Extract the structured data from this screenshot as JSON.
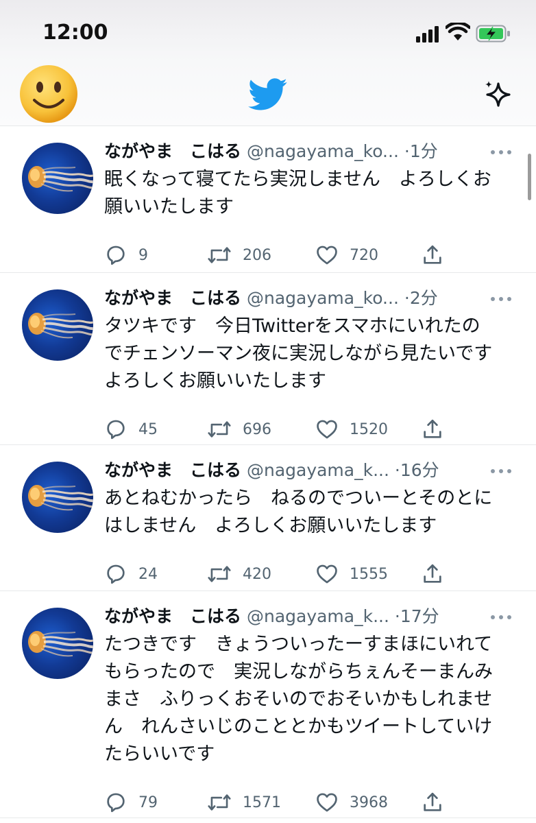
{
  "status_bar": {
    "time": "12:00"
  },
  "header": {
    "logo": "twitter-bird-icon",
    "left": "smiley-avatar-icon",
    "right": "sparkle-icon"
  },
  "colors": {
    "twitter_blue": "#1d9bf0",
    "text": "#0f1419",
    "secondary": "#536471"
  },
  "tweets": [
    {
      "name": "ながやま　こはる",
      "handle": "@nagayama_ko...",
      "time": "1分",
      "text": "眠くなって寝てたら実況しません　よろしくお\n願いいたします",
      "replies": "9",
      "retweets": "206",
      "likes": "720"
    },
    {
      "name": "ながやま　こはる",
      "handle": "@nagayama_ko...",
      "time": "2分",
      "text": "タツキです　今日Twitterをスマホにいれたの\nでチェンソーマン夜に実況しながら見たいです\nよろしくお願いいたします",
      "replies": "45",
      "retweets": "696",
      "likes": "1520"
    },
    {
      "name": "ながやま　こはる",
      "handle": "@nagayama_k...",
      "time": "16分",
      "text": "あとねむかったら　ねるのでついーとそのとに\nはしません　よろしくお願いいたします",
      "replies": "24",
      "retweets": "420",
      "likes": "1555"
    },
    {
      "name": "ながやま　こはる",
      "handle": "@nagayama_k...",
      "time": "17分",
      "text": "たつきです　きょうついったーすまほにいれて\nもらったので　実況しながらちぇんそーまんみ\nまさ　ふりっくおそいのでおそいかもしれませ\nん　れんさいじのこととかもツイートしていけ\nたらいいです",
      "replies": "79",
      "retweets": "1571",
      "likes": "3968"
    }
  ]
}
